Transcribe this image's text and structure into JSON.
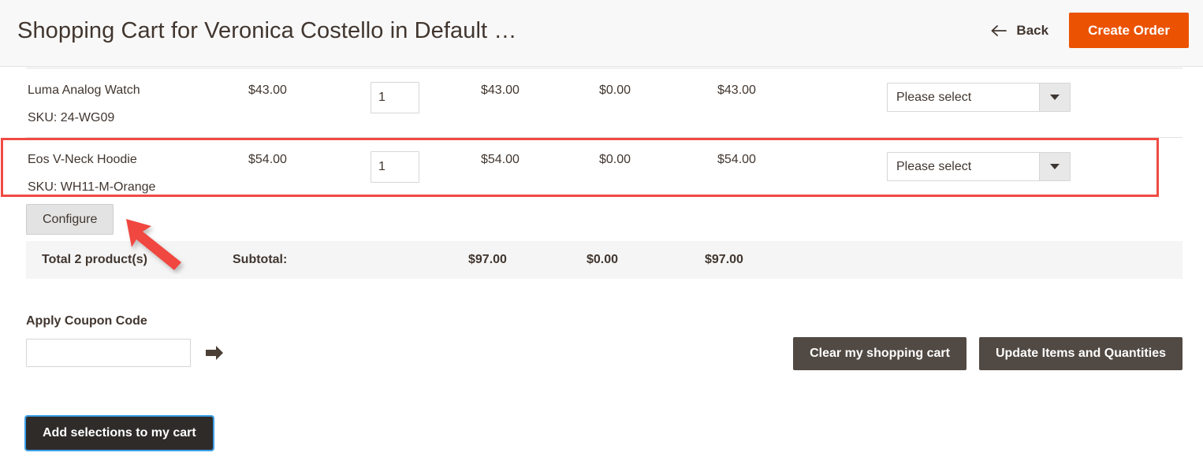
{
  "header": {
    "title": "Shopping Cart for Veronica Costello in Default …",
    "back_label": "Back",
    "back_icon": "arrow-left-icon",
    "create_order_label": "Create Order",
    "accent_color": "#eb5202"
  },
  "cart": {
    "rows": [
      {
        "name": "Luma Analog Watch",
        "sku": "SKU: 24-WG09",
        "price": "$43.00",
        "qty": "1",
        "subtotal": "$43.00",
        "discount": "$0.00",
        "row_total": "$43.00",
        "action_select": "Please select"
      },
      {
        "name": "Eos V-Neck Hoodie",
        "sku": "SKU: WH11-M-Orange",
        "price": "$54.00",
        "qty": "1",
        "subtotal": "$54.00",
        "discount": "$0.00",
        "row_total": "$54.00",
        "action_select": "Please select"
      }
    ],
    "configure_label": "Configure",
    "totals": {
      "label": "Total 2 product(s)",
      "subtotal_label": "Subtotal:",
      "subtotal": "$97.00",
      "discount": "$0.00",
      "total": "$97.00"
    },
    "highlight_color": "#f04a43",
    "annotation_arrow": "red-arrow-pointing-to-configure"
  },
  "coupon": {
    "label": "Apply Coupon Code",
    "value": "",
    "placeholder": "",
    "apply_icon": "arrow-right-icon"
  },
  "actions": {
    "clear_cart_label": "Clear my shopping cart",
    "update_items_label": "Update Items and Quantities",
    "add_selections_label": "Add selections to my cart",
    "focus_color": "#3c9fe8"
  }
}
